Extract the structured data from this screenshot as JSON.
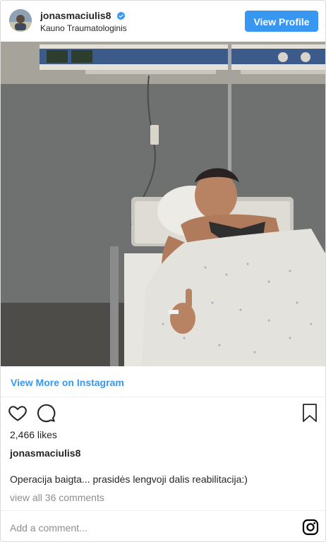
{
  "header": {
    "username": "jonasmaciulis8",
    "location": "Kauno Traumatologinis",
    "view_profile_label": "View Profile"
  },
  "post": {
    "view_more_label": "View More on Instagram",
    "likes": "2,466 likes",
    "owner": "jonasmaciulis8",
    "caption": "Operacija baigta... prasidės lengvoji dalis reabilitacija:)",
    "comments_link": "view all 36 comments",
    "add_comment_placeholder": "Add a comment..."
  },
  "icons": {
    "verified": "verified-badge-icon",
    "like": "heart-icon",
    "comment": "comment-bubble-icon",
    "save": "bookmark-icon",
    "instagram": "instagram-logo-icon"
  },
  "colors": {
    "accent": "#3897f0",
    "muted": "#8e8e8e",
    "text": "#262626"
  }
}
